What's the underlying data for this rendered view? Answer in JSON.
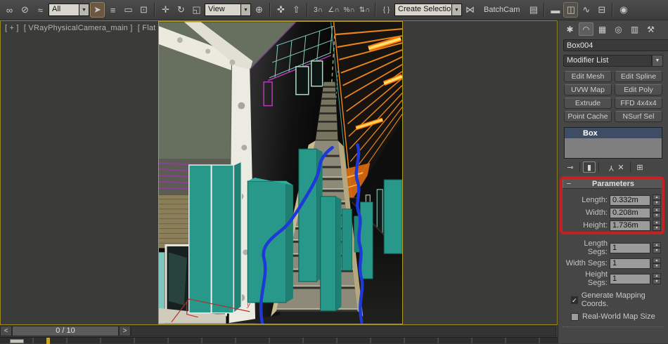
{
  "toolbar": {
    "selection_filter_value": "All",
    "ref_coord_value": "View",
    "named_selection_placeholder": "Create Selection Se",
    "batchcam_label": "BatchCam"
  },
  "icons": {
    "select_and_link": "∞",
    "unlink_selection": "⊘",
    "bind_to_spacewarp": "≈",
    "combo_arrow": "▼",
    "select_object": "➤",
    "select_by_name": "≡",
    "selection_region": "▭",
    "window_crossing": "⊡",
    "select_move": "✛",
    "select_rotate": "↻",
    "select_scale": "◱",
    "pivot_center": "⊕",
    "select_manipulate": "✜",
    "keyboard_override": "⇧",
    "snap_3d": "3∩",
    "snap_angle": "∠∩",
    "snap_percent": "%∩",
    "snap_spinner": "⇅∩",
    "named_sets": "{ }",
    "mirror": "⋈",
    "layer_manager": "▤",
    "ribbon": "▬",
    "curve_editor_folder": "◫",
    "track_view": "∿",
    "schematic_view": "⊟",
    "render_setup": "◉",
    "tab_create": "✱",
    "tab_modify": "◠",
    "tab_hierarchy": "▦",
    "tab_motion": "◎",
    "tab_display": "▥",
    "tab_utilities": "⚒",
    "stack_pin": "⊸",
    "stack_show_end_result": "▮",
    "stack_make_unique": "Y",
    "stack_remove_modifier": "✕",
    "stack_configure": "⊞",
    "spin_up": "▲",
    "spin_down": "▼",
    "check": "✓",
    "rollout_collapse": "−"
  },
  "viewport": {
    "label_plus": "[ + ]",
    "label_camera": "[ VRayPhysicalCamera_main ]",
    "label_shading": "[ Flat + Edged Faces ]",
    "axis_label": "y"
  },
  "command_panel": {
    "object_name": "Box004",
    "object_color": "#21998a",
    "modifier_list_label": "Modifier List",
    "modifier_buttons": [
      "Edit Mesh",
      "Edit Spline",
      "UVW Map",
      "Edit Poly",
      "Extrude",
      "FFD 4x4x4",
      "Point Cache",
      "NSurf Sel"
    ],
    "stack_item_label": "Box",
    "parameters": {
      "title": "Parameters",
      "fields": [
        {
          "label": "Length:",
          "value": "0.332m"
        },
        {
          "label": "Width:",
          "value": "0.208m"
        },
        {
          "label": "Height:",
          "value": "1.736m"
        },
        {
          "label": "Length Segs:",
          "value": "1"
        },
        {
          "label": "Width Segs:",
          "value": "1"
        },
        {
          "label": "Height Segs:",
          "value": "1"
        }
      ],
      "checkboxes": [
        {
          "label": "Generate Mapping Coords.",
          "checked": true
        },
        {
          "label": "Real-World Map Size",
          "checked": false
        }
      ]
    },
    "highlight_color": "#c42222"
  },
  "timeline": {
    "prev": "<",
    "next": ">",
    "frame_label": "0 / 10"
  },
  "colors": {
    "active_viewport_border": "#b6a11e",
    "teal_box": "#27988a",
    "ceiling_orange": "#e6831c",
    "spline_blue": "#1d39d8"
  }
}
